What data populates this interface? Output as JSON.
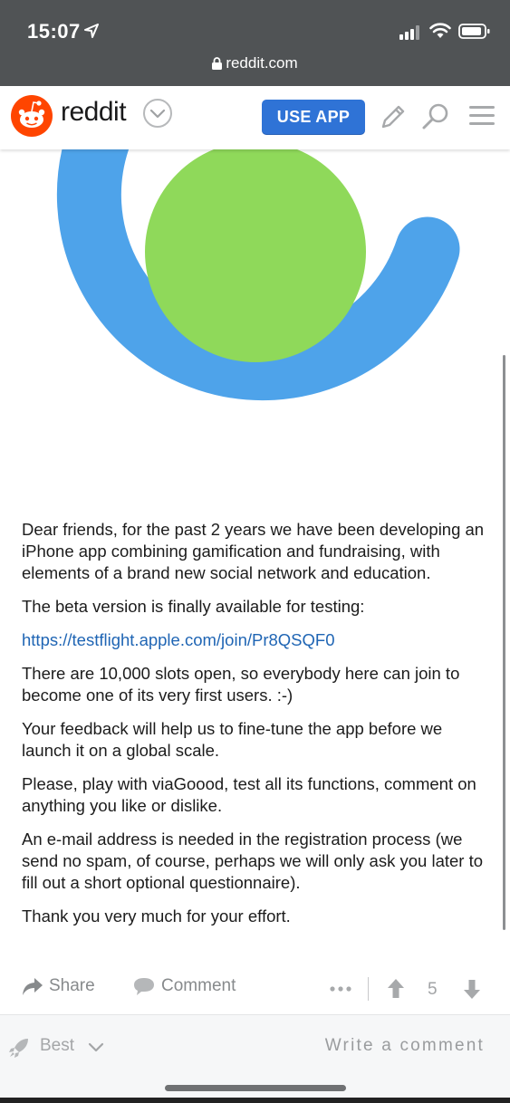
{
  "status": {
    "time": "15:07",
    "url": "reddit.com"
  },
  "header": {
    "brand": "reddit",
    "use_app_label": "USE APP"
  },
  "post": {
    "paragraphs": [
      "Dear friends, for the past 2 years we have been developing an iPhone app combining gamification and fundraising, with elements of a brand new social network and education.",
      "The beta version is finally available for testing:"
    ],
    "link": "https://testflight.apple.com/join/Pr8QSQF0",
    "paragraphs_after": [
      "There are 10,000 slots open, so everybody here can join to become one of its very first users. :-)",
      "Your feedback will help us to fine-tune the app before we launch it on a global scale.",
      "Please, play with viaGoood, test all its functions, comment on anything you like or dislike.",
      "An e-mail address is needed in the registration process (we send no spam, of course, perhaps we will only ask you later to fill out a short optional questionnaire).",
      "Thank you very much for your effort."
    ]
  },
  "actions": {
    "share_label": "Share",
    "comment_label": "Comment",
    "score": "5"
  },
  "bottom": {
    "sort_label": "Best",
    "write_placeholder": "Write a comment"
  },
  "colors": {
    "accent": "#2f73d6",
    "logo_orange": "#ff4500",
    "ring_blue": "#4ea3ea",
    "dot_green": "#8fd95a",
    "link": "#1f65b4"
  },
  "icons": [
    "location-arrow-icon",
    "signal-icon",
    "wifi-icon",
    "battery-icon",
    "lock-icon",
    "reddit-logo-icon",
    "chevron-down-icon",
    "pencil-icon",
    "search-icon",
    "menu-icon",
    "share-icon",
    "comment-icon",
    "more-icon",
    "upvote-icon",
    "downvote-icon",
    "rocket-icon"
  ]
}
